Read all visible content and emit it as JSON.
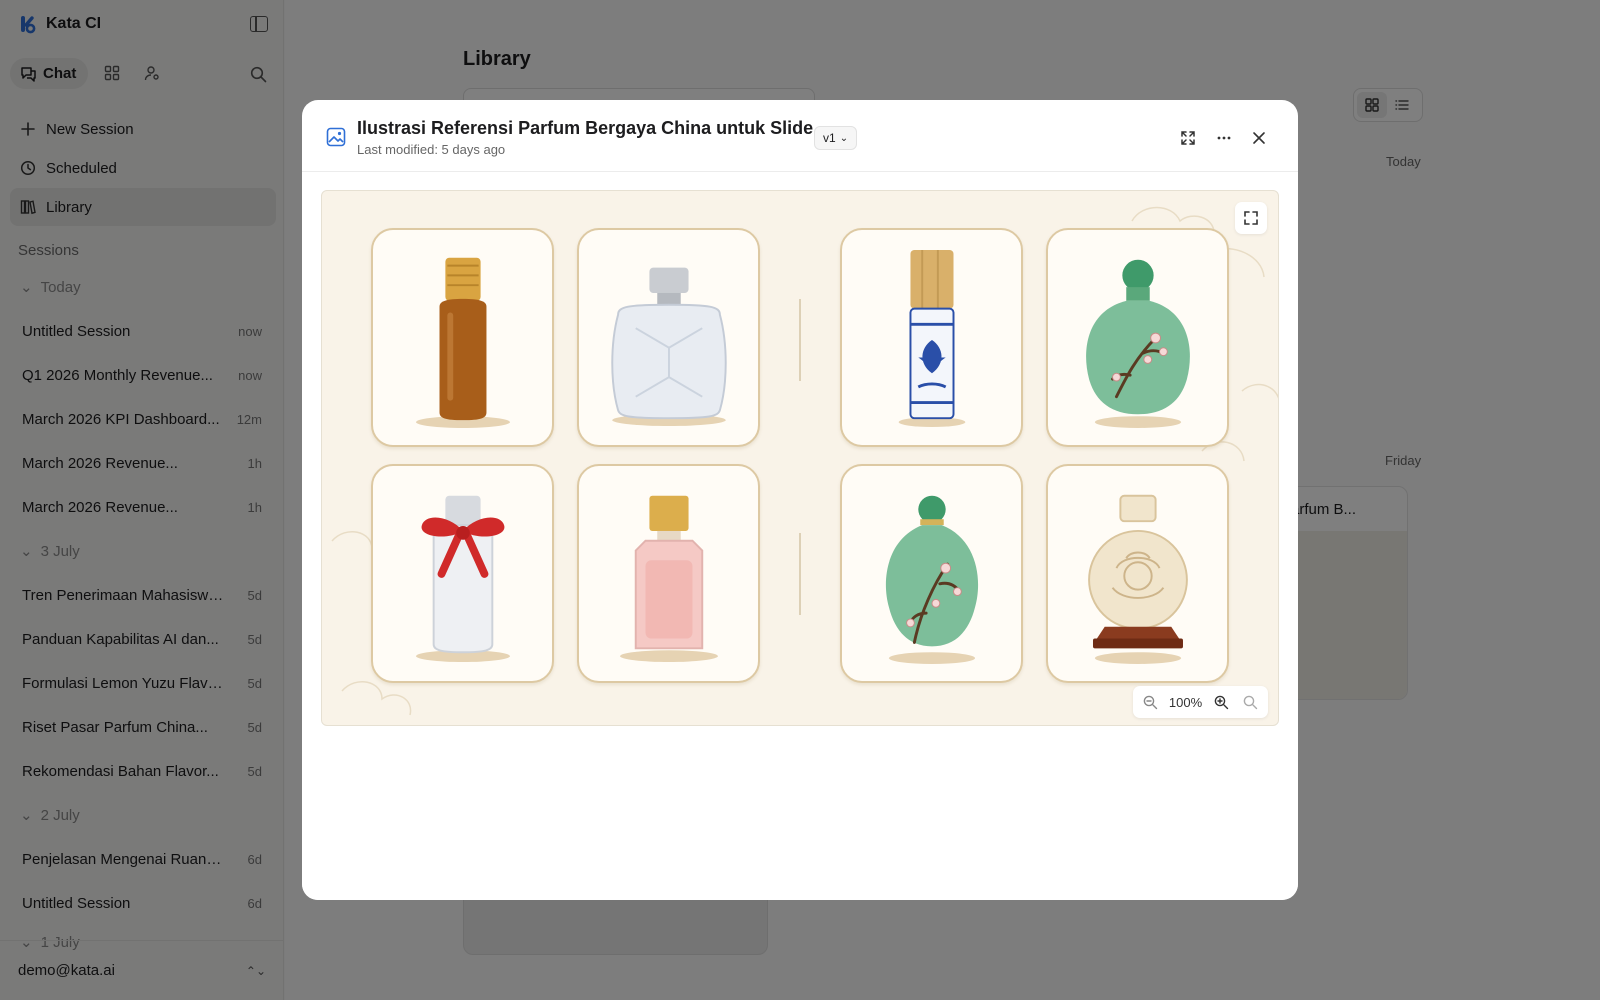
{
  "app": {
    "name": "Kata CI"
  },
  "modes": {
    "chat_label": "Chat"
  },
  "nav": [
    {
      "label": "New Session",
      "icon": "plus-icon"
    },
    {
      "label": "Scheduled",
      "icon": "clock-icon"
    },
    {
      "label": "Library",
      "icon": "library-icon"
    }
  ],
  "sessions": {
    "heading": "Sessions",
    "groups": [
      {
        "label": "Today",
        "items": [
          {
            "title": "Untitled Session",
            "age": "now"
          },
          {
            "title": "Q1 2026 Monthly Revenue...",
            "age": "now"
          },
          {
            "title": "March 2026 KPI Dashboard...",
            "age": "12m"
          },
          {
            "title": "March 2026 Revenue...",
            "age": "1h"
          },
          {
            "title": "March 2026 Revenue...",
            "age": "1h"
          }
        ]
      },
      {
        "label": "3 July",
        "items": [
          {
            "title": "Tren Penerimaan Mahasiswa I...",
            "age": "5d"
          },
          {
            "title": "Panduan Kapabilitas AI dan...",
            "age": "5d"
          },
          {
            "title": "Formulasi Lemon Yuzu Flavor...",
            "age": "5d"
          },
          {
            "title": "Riset Pasar Parfum China...",
            "age": "5d"
          },
          {
            "title": "Rekomendasi Bahan Flavor...",
            "age": "5d"
          }
        ]
      },
      {
        "label": "2 July",
        "items": [
          {
            "title": "Penjelasan Mengenai Ruang...",
            "age": "6d"
          },
          {
            "title": "Untitled Session",
            "age": "6d"
          }
        ]
      },
      {
        "label": "1 July",
        "items": []
      }
    ]
  },
  "user": {
    "email": "demo@kata.ai"
  },
  "library": {
    "title": "Library",
    "date_today": "Today",
    "date_friday": "Friday",
    "card_title": "Parfum B..."
  },
  "modal": {
    "title": "Ilustrasi Referensi Parfum Bergaya China untuk Slide",
    "subtitle": "Last modified: 5 days ago",
    "version": "v1",
    "zoom": "100%"
  },
  "colors": {
    "accent": "#2f6fd6",
    "tile_border": "#ddc9a3",
    "canvas_bg": "#f9f3e8"
  }
}
